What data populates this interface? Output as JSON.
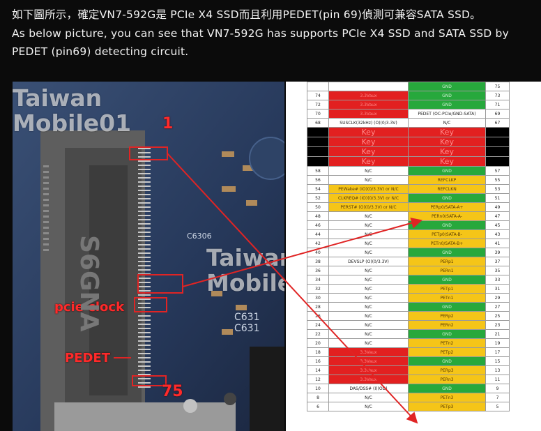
{
  "caption": {
    "line_zh": "如下圖所示，確定VN7-592G是 PCIe X4 SSD而且利用PEDET(pin 69)偵測可兼容SATA SSD。",
    "line_en": "As below picture, you can see that VN7-592G has supports PCIe X4 SSD and SATA SSD by PEDET (pin69) detecting circuit."
  },
  "photo": {
    "watermark_top": [
      "Taiwan",
      "Mobile01"
    ],
    "watermark_mid": [
      "Taiwan",
      "Mobile01"
    ],
    "pin1_label": "1",
    "pcie_clock_label": "pcie clock",
    "pedet_label": "PEDET",
    "pin75_label": "75",
    "chip_text": [
      "C6306",
      "C631",
      "C631"
    ],
    "silk_text": "S6GNA"
  },
  "table": {
    "rows": [
      {
        "l_num": "",
        "l_sig": "",
        "l_cls": "white",
        "r_sig": "GND",
        "r_cls": "green",
        "r_num": "75"
      },
      {
        "l_num": "74",
        "l_sig": "3.3Vaux",
        "l_cls": "red",
        "r_sig": "GND",
        "r_cls": "green",
        "r_num": "73"
      },
      {
        "l_num": "72",
        "l_sig": "3.3Vaux",
        "l_cls": "red",
        "r_sig": "GND",
        "r_cls": "green",
        "r_num": "71"
      },
      {
        "l_num": "70",
        "l_sig": "3.3Vaux",
        "l_cls": "red",
        "r_sig": "PEDET (OC-PCIe/GND-SATA)",
        "r_cls": "white",
        "r_num": "69"
      },
      {
        "l_num": "68",
        "l_sig": "SUSCLK(32kHz) (O)(0/3.3V)",
        "l_cls": "white",
        "r_sig": "N/C",
        "r_cls": "white",
        "r_num": "67"
      },
      {
        "l_num": "",
        "l_sig": "Key",
        "l_cls": "key",
        "r_sig": "Key",
        "r_cls": "key",
        "r_num": ""
      },
      {
        "l_num": "",
        "l_sig": "Key",
        "l_cls": "key",
        "r_sig": "Key",
        "r_cls": "key",
        "r_num": ""
      },
      {
        "l_num": "",
        "l_sig": "Key",
        "l_cls": "key",
        "r_sig": "Key",
        "r_cls": "key",
        "r_num": ""
      },
      {
        "l_num": "",
        "l_sig": "Key",
        "l_cls": "key",
        "r_sig": "Key",
        "r_cls": "key",
        "r_num": ""
      },
      {
        "l_num": "58",
        "l_sig": "N/C",
        "l_cls": "white",
        "r_sig": "GND",
        "r_cls": "green",
        "r_num": "57"
      },
      {
        "l_num": "56",
        "l_sig": "N/C",
        "l_cls": "white",
        "r_sig": "REFCLKP",
        "r_cls": "orange",
        "r_num": "55"
      },
      {
        "l_num": "54",
        "l_sig": "PEWake# (IO)(0/3.3V) or N/C",
        "l_cls": "orange",
        "r_sig": "REFCLKN",
        "r_cls": "orange",
        "r_num": "53"
      },
      {
        "l_num": "52",
        "l_sig": "CLKREQ# (IO)(0/3.3V) or N/C",
        "l_cls": "orange",
        "r_sig": "GND",
        "r_cls": "green",
        "r_num": "51"
      },
      {
        "l_num": "50",
        "l_sig": "PERST# (O)(0/3.3V) or N/C",
        "l_cls": "orange",
        "r_sig": "PERp0/SATA-A+",
        "r_cls": "orange",
        "r_num": "49"
      },
      {
        "l_num": "48",
        "l_sig": "N/C",
        "l_cls": "white",
        "r_sig": "PERn0/SATA-A-",
        "r_cls": "orange",
        "r_num": "47"
      },
      {
        "l_num": "46",
        "l_sig": "N/C",
        "l_cls": "white",
        "r_sig": "GND",
        "r_cls": "green",
        "r_num": "45"
      },
      {
        "l_num": "44",
        "l_sig": "N/C",
        "l_cls": "white",
        "r_sig": "PETp0/SATA-B-",
        "r_cls": "orange",
        "r_num": "43"
      },
      {
        "l_num": "42",
        "l_sig": "N/C",
        "l_cls": "white",
        "r_sig": "PETn0/SATA-B+",
        "r_cls": "orange",
        "r_num": "41"
      },
      {
        "l_num": "40",
        "l_sig": "N/C",
        "l_cls": "white",
        "r_sig": "GND",
        "r_cls": "green",
        "r_num": "39"
      },
      {
        "l_num": "38",
        "l_sig": "DEVSLP (O)(0/3.3V)",
        "l_cls": "white",
        "r_sig": "PERp1",
        "r_cls": "orange",
        "r_num": "37"
      },
      {
        "l_num": "36",
        "l_sig": "N/C",
        "l_cls": "white",
        "r_sig": "PERn1",
        "r_cls": "orange",
        "r_num": "35"
      },
      {
        "l_num": "34",
        "l_sig": "N/C",
        "l_cls": "white",
        "r_sig": "GND",
        "r_cls": "green",
        "r_num": "33"
      },
      {
        "l_num": "32",
        "l_sig": "N/C",
        "l_cls": "white",
        "r_sig": "PETp1",
        "r_cls": "orange",
        "r_num": "31"
      },
      {
        "l_num": "30",
        "l_sig": "N/C",
        "l_cls": "white",
        "r_sig": "PETn1",
        "r_cls": "orange",
        "r_num": "29"
      },
      {
        "l_num": "28",
        "l_sig": "N/C",
        "l_cls": "white",
        "r_sig": "GND",
        "r_cls": "green",
        "r_num": "27"
      },
      {
        "l_num": "26",
        "l_sig": "N/C",
        "l_cls": "white",
        "r_sig": "PERp2",
        "r_cls": "orange",
        "r_num": "25"
      },
      {
        "l_num": "24",
        "l_sig": "N/C",
        "l_cls": "white",
        "r_sig": "PERn2",
        "r_cls": "orange",
        "r_num": "23"
      },
      {
        "l_num": "22",
        "l_sig": "N/C",
        "l_cls": "white",
        "r_sig": "GND",
        "r_cls": "green",
        "r_num": "21"
      },
      {
        "l_num": "20",
        "l_sig": "N/C",
        "l_cls": "white",
        "r_sig": "PETn2",
        "r_cls": "orange",
        "r_num": "19"
      },
      {
        "l_num": "18",
        "l_sig": "3.3Vaux",
        "l_cls": "red",
        "r_sig": "PETp2",
        "r_cls": "orange",
        "r_num": "17"
      },
      {
        "l_num": "16",
        "l_sig": "3.3Vaux",
        "l_cls": "red",
        "r_sig": "GND",
        "r_cls": "green",
        "r_num": "15"
      },
      {
        "l_num": "14",
        "l_sig": "3.3Vaux",
        "l_cls": "red",
        "r_sig": "PERp3",
        "r_cls": "orange",
        "r_num": "13"
      },
      {
        "l_num": "12",
        "l_sig": "3.3Vaux",
        "l_cls": "red",
        "r_sig": "PERn3",
        "r_cls": "orange",
        "r_num": "11"
      },
      {
        "l_num": "10",
        "l_sig": "DAS/DSS# (I)(OD)",
        "l_cls": "white",
        "r_sig": "GND",
        "r_cls": "green",
        "r_num": "9"
      },
      {
        "l_num": "8",
        "l_sig": "N/C",
        "l_cls": "white",
        "r_sig": "PETn3",
        "r_cls": "orange",
        "r_num": "7"
      },
      {
        "l_num": "6",
        "l_sig": "N/C",
        "l_cls": "white",
        "r_sig": "PETp3",
        "r_cls": "orange",
        "r_num": "5"
      }
    ]
  },
  "colors": {
    "pcb_blue": "#2b3d5c",
    "arrow_red": "#e02424",
    "label_red": "#ff2a2a"
  }
}
